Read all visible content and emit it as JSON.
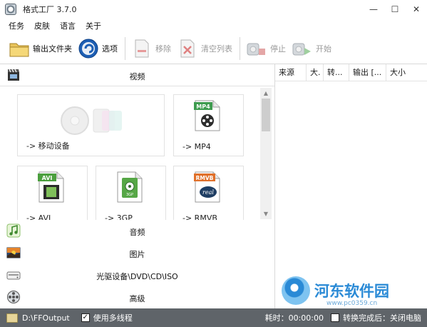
{
  "window": {
    "title": "格式工厂 3.7.0",
    "minimize": "—",
    "maximize": "☐",
    "close": "✕"
  },
  "menu": [
    "任务",
    "皮肤",
    "语言",
    "关于"
  ],
  "toolbar": {
    "output_folder": "输出文件夹",
    "options": "选项",
    "remove": "移除",
    "clear_list": "清空列表",
    "stop": "停止",
    "start": "开始"
  },
  "categories": {
    "video": "视频",
    "audio": "音频",
    "image": "图片",
    "rom": "光驱设备\\DVD\\CD\\ISO",
    "advanced": "高级"
  },
  "tiles": {
    "mobile": "-> 移动设备",
    "mp4": "-> MP4",
    "avi": "-> AVI",
    "gp3": "-> 3GP",
    "rmvb": "-> RMVB",
    "mp4_badge": "MP4",
    "avi_badge": "AVI",
    "gp3_badge": "3GP",
    "rmvb_badge": "RMVB",
    "real_badge": "real"
  },
  "task_columns": [
    "来源",
    "大.",
    "转...",
    "输出 [...",
    "大小"
  ],
  "status": {
    "output_path": "D:\\FFOutput",
    "multithread_label": "使用多线程",
    "multithread_checked": true,
    "elapsed_label": "耗时：00:00:00",
    "shutdown_label": "转换完成后：关闭电脑",
    "shutdown_checked": false
  },
  "watermark": {
    "site_name": "河东软件园",
    "url": "www.pc0359.cn"
  },
  "colors": {
    "statusbar": "#5f6469",
    "watermark": "#2a8ad6"
  }
}
